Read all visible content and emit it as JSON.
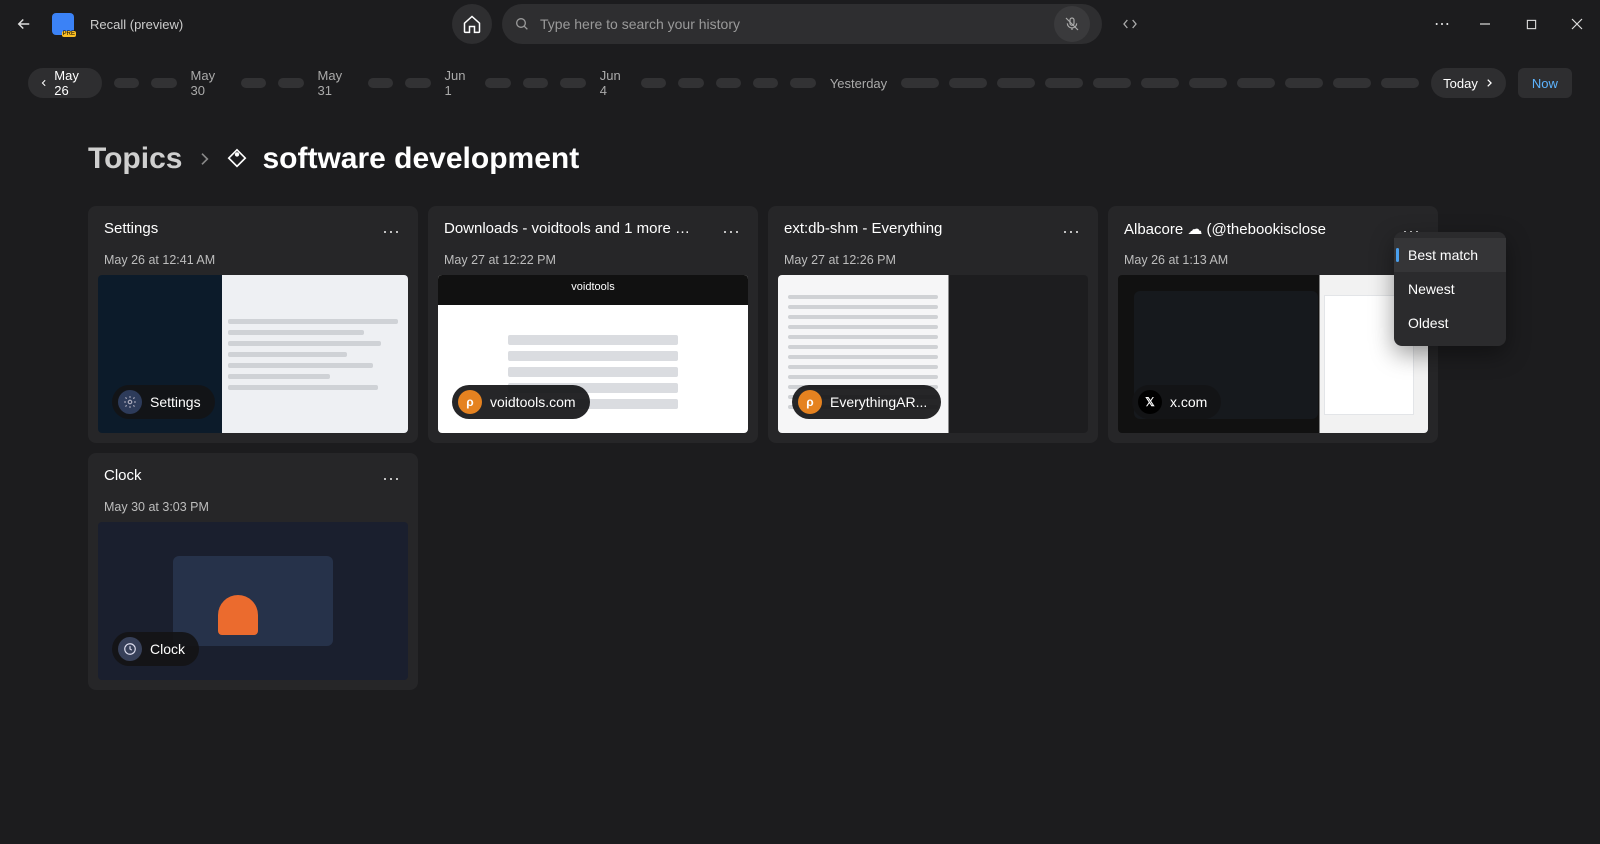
{
  "app": {
    "title": "Recall (preview)"
  },
  "search": {
    "placeholder": "Type here to search your history"
  },
  "timeline": {
    "start_date": "May 26",
    "dates": [
      "May 30",
      "May 31",
      "Jun 1",
      "Jun 4",
      "Yesterday"
    ],
    "today_label": "Today",
    "now_label": "Now"
  },
  "breadcrumb": {
    "topics_label": "Topics",
    "current": "software development"
  },
  "sort_menu": {
    "items": [
      "Best match",
      "Newest",
      "Oldest"
    ],
    "selected_index": 0
  },
  "cards": [
    {
      "title": "Settings",
      "date": "May 26 at 12:41 AM",
      "badge_label": "Settings",
      "badge_type": "gear",
      "thumb": "settings"
    },
    {
      "title": "Downloads - voidtools and 1 more page...",
      "date": "May 27 at 12:22 PM",
      "badge_label": "voidtools.com",
      "badge_type": "orange",
      "thumb": "voidtools"
    },
    {
      "title": "ext:db-shm - Everything",
      "date": "May 27 at 12:26 PM",
      "badge_label": "EverythingAR...",
      "badge_type": "orange",
      "thumb": "everything"
    },
    {
      "title": "Albacore ☁ (@thebookisclose",
      "date": "May 26 at 1:13 AM",
      "badge_label": "x.com",
      "badge_type": "x",
      "thumb": "xcom"
    },
    {
      "title": "Clock",
      "date": "May 30 at 3:03 PM",
      "badge_label": "Clock",
      "badge_type": "clockicon",
      "thumb": "clock"
    }
  ]
}
